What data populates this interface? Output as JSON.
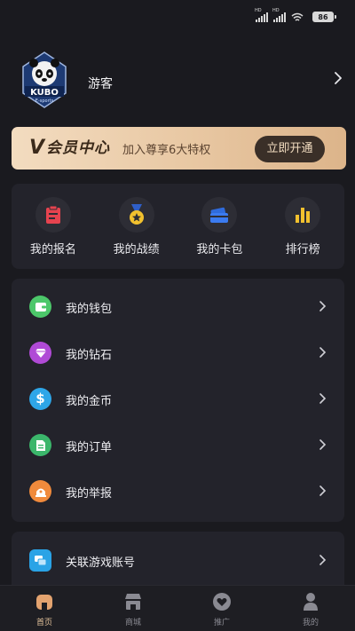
{
  "status_bar": {
    "network_badge": "HD",
    "battery": "86"
  },
  "profile": {
    "avatar_text": "KUBO",
    "avatar_sub": "E-sports",
    "nickname": "游客"
  },
  "vip": {
    "logo_v": "V",
    "logo_text": "会员中心",
    "desc": "加入尊享6大特权",
    "button": "立即开通"
  },
  "quick_links": [
    {
      "label": "我的报名",
      "icon": "clipboard-icon"
    },
    {
      "label": "我的战绩",
      "icon": "medal-icon"
    },
    {
      "label": "我的卡包",
      "icon": "card-wallet-icon"
    },
    {
      "label": "排行榜",
      "icon": "bar-chart-icon"
    }
  ],
  "menu": [
    {
      "label": "我的钱包",
      "icon": "wallet-icon",
      "color": "#4cc76a"
    },
    {
      "label": "我的钻石",
      "icon": "diamond-icon",
      "color": "#b04ad6"
    },
    {
      "label": "我的金币",
      "icon": "dollar-icon",
      "color": "#2ea6e8"
    },
    {
      "label": "我的订单",
      "icon": "document-icon",
      "color": "#3bb66b"
    },
    {
      "label": "我的举报",
      "icon": "report-icon",
      "color": "#f08a3c"
    }
  ],
  "menu2": [
    {
      "label": "关联游戏账号",
      "icon": "link-account-icon",
      "color": "#2aa3e6"
    }
  ],
  "tabs": [
    {
      "label": "首页",
      "icon": "home-icon",
      "active": true
    },
    {
      "label": "商城",
      "icon": "store-icon",
      "active": false
    },
    {
      "label": "推广",
      "icon": "heart-icon",
      "active": false
    },
    {
      "label": "我的",
      "icon": "person-icon",
      "active": false
    }
  ],
  "colors": {
    "background": "#1a1a1f",
    "card": "#23232b",
    "vip_gold": "#e8c7a2",
    "accent_tab": "#e3c29b"
  }
}
